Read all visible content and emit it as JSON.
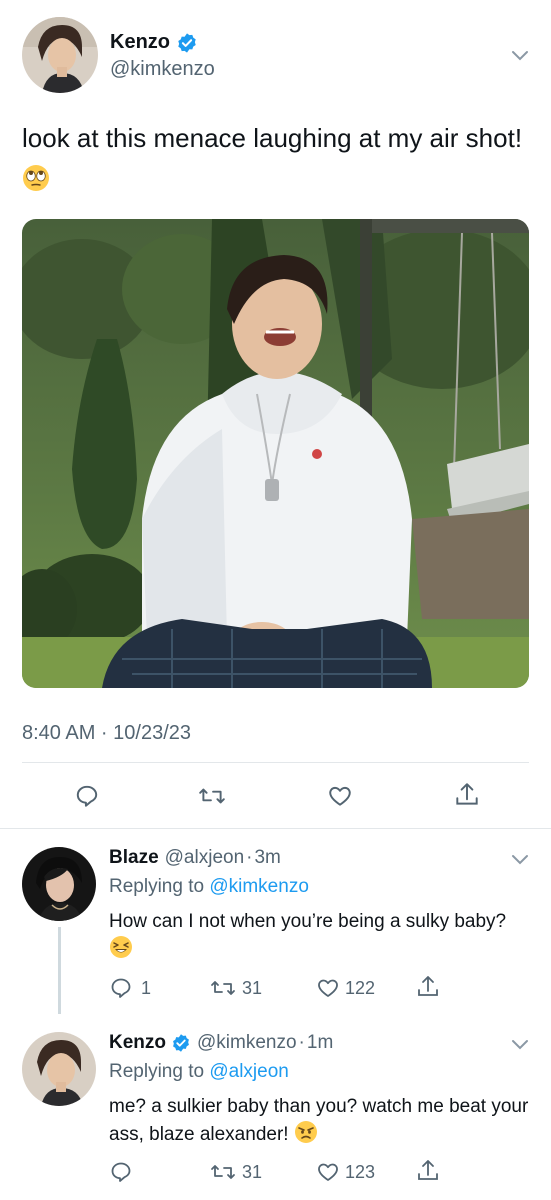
{
  "main_tweet": {
    "author_name": "Kenzo",
    "author_handle": "@kimkenzo",
    "verified": true,
    "text": "look at this menace laughing at my air shot!",
    "emoji": "face-with-rolling-eyes",
    "timestamp": "8:40 AM · 10/23/23",
    "actions": [
      "reply",
      "retweet",
      "like",
      "share"
    ]
  },
  "replies": [
    {
      "author_name": "Blaze",
      "author_handle": "@alxjeon",
      "time": "3m",
      "replying_label": "Replying to",
      "replying_to": "@kimkenzo",
      "text": "How can I not when you’re being a sulky baby?",
      "emoji": "grinning-squinting-face",
      "reply_count": "1",
      "retweet_count": "31",
      "like_count": "122"
    },
    {
      "author_name": "Kenzo",
      "author_handle": "@kimkenzo",
      "verified": true,
      "time": "1m",
      "replying_label": "Replying to",
      "replying_to": "@alxjeon",
      "text": "me? a sulkier baby than you? watch me beat your ass, blaze alexander!",
      "emoji": "angry-face",
      "reply_count": "",
      "retweet_count": "31",
      "like_count": "123"
    }
  ],
  "colors": {
    "accent": "#1d9bf0",
    "secondary_text": "#536471",
    "divider": "#e3e7ea"
  }
}
